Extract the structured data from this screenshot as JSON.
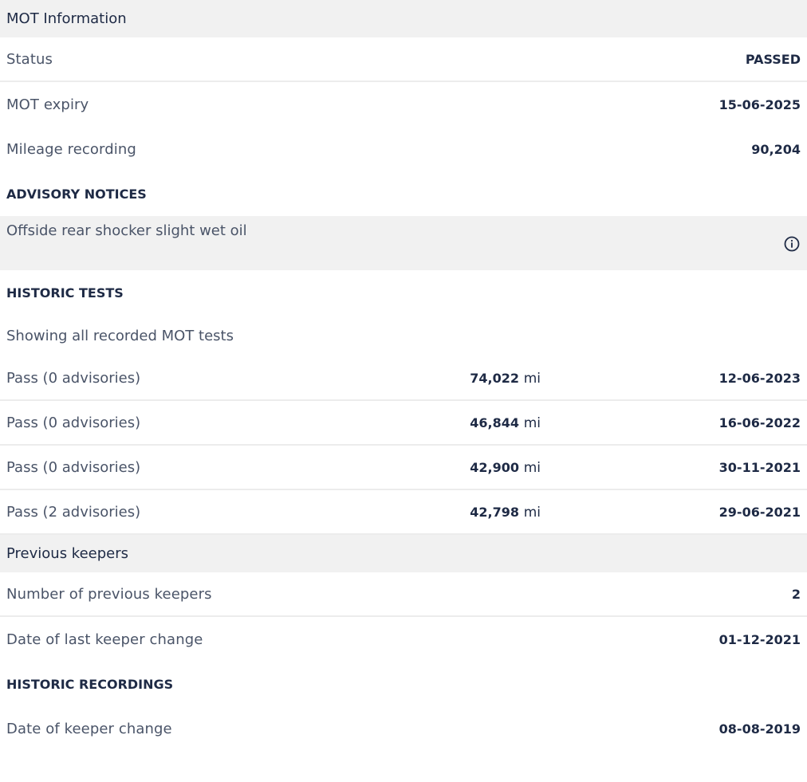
{
  "mot": {
    "section_title": "MOT Information",
    "rows": [
      {
        "label": "Status",
        "value": "PASSED"
      },
      {
        "label": "MOT expiry",
        "value": "15-06-2025"
      },
      {
        "label": "Mileage recording",
        "value": "90,204"
      }
    ]
  },
  "advisory": {
    "heading": "ADVISORY NOTICES",
    "notice": "Offside rear shocker slight wet oil",
    "icon": "info-icon"
  },
  "historic_tests": {
    "heading": "HISTORIC TESTS",
    "description": "Showing all recorded MOT tests",
    "unit": "mi",
    "tests": [
      {
        "result": "Pass (0 advisories)",
        "mileage": "74,022",
        "date": "12-06-2023"
      },
      {
        "result": "Pass (0 advisories)",
        "mileage": "46,844",
        "date": "16-06-2022"
      },
      {
        "result": "Pass (0 advisories)",
        "mileage": "42,900",
        "date": "30-11-2021"
      },
      {
        "result": "Pass (2 advisories)",
        "mileage": "42,798",
        "date": "29-06-2021"
      }
    ]
  },
  "keepers": {
    "section_title": "Previous keepers",
    "rows": [
      {
        "label": "Number of previous keepers",
        "value": "2"
      },
      {
        "label": "Date of last keeper change",
        "value": "01-12-2021"
      }
    ]
  },
  "historic_recordings": {
    "heading": "HISTORIC RECORDINGS",
    "rows": [
      {
        "label": "Date of keeper change",
        "value": "08-08-2019"
      }
    ]
  },
  "colors": {
    "text": "#1e2a45",
    "muted_text": "#4a5468",
    "section_bg": "#f1f1f1",
    "divider": "#ececec"
  }
}
